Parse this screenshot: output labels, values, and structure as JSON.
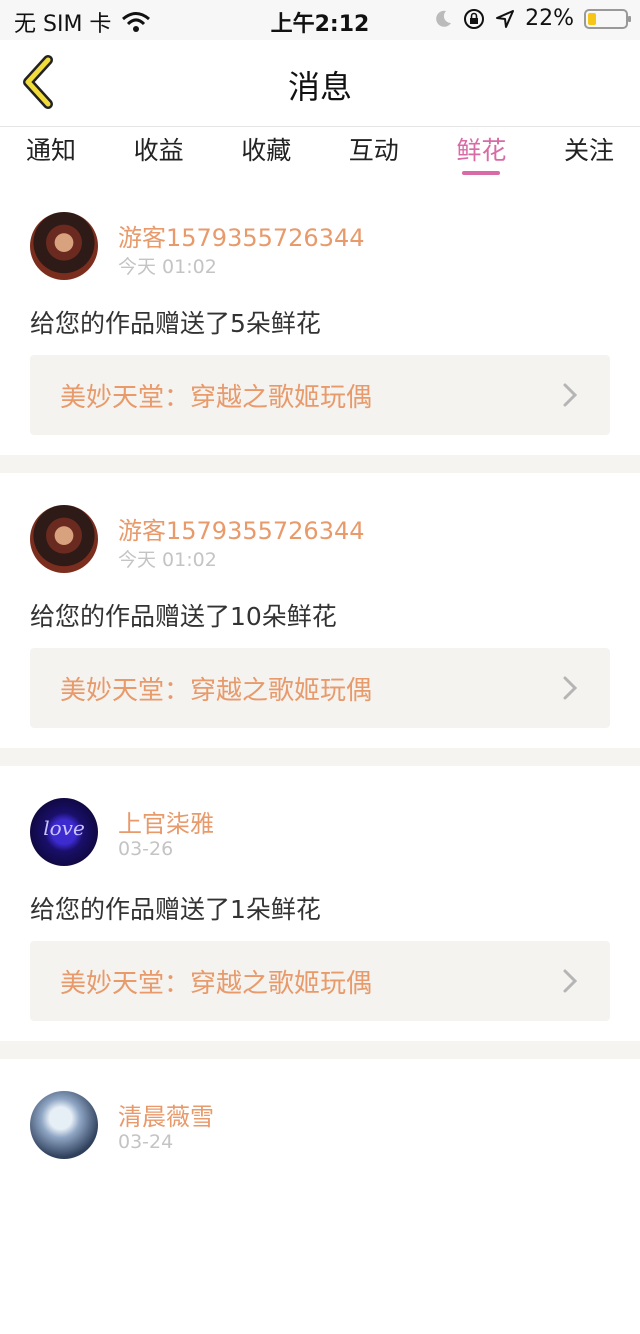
{
  "status_bar": {
    "carrier": "无 SIM 卡",
    "time": "上午2:12",
    "battery_percent": "22%",
    "battery_level": 0.22,
    "icons": [
      "wifi-icon",
      "moon-icon",
      "rotation-lock-icon",
      "location-icon",
      "battery-icon"
    ]
  },
  "header": {
    "title": "消息",
    "back_icon": "chevron-left-icon"
  },
  "tabs": [
    {
      "label": "通知",
      "active": false
    },
    {
      "label": "收益",
      "active": false
    },
    {
      "label": "收藏",
      "active": false
    },
    {
      "label": "互动",
      "active": false
    },
    {
      "label": "鲜花",
      "active": true
    },
    {
      "label": "关注",
      "active": false
    }
  ],
  "colors": {
    "accent": "#d86aa6",
    "name_orange": "#e89a6b",
    "card_bg": "#f4f3ef",
    "divider": "#f5f4f0"
  },
  "messages": [
    {
      "username": "游客1579355726344",
      "time": "今天 01:02",
      "text": "给您的作品赠送了5朵鲜花",
      "work_title": "美妙天堂：穿越之歌姬玩偶"
    },
    {
      "username": "游客1579355726344",
      "time": "今天 01:02",
      "text": "给您的作品赠送了10朵鲜花",
      "work_title": "美妙天堂：穿越之歌姬玩偶"
    },
    {
      "username": "上官柒雅",
      "avatar_text": "love",
      "time": "03-26",
      "text": "给您的作品赠送了1朵鲜花",
      "work_title": "美妙天堂：穿越之歌姬玩偶"
    },
    {
      "username": "清晨薇雪",
      "time": "03-24"
    }
  ]
}
